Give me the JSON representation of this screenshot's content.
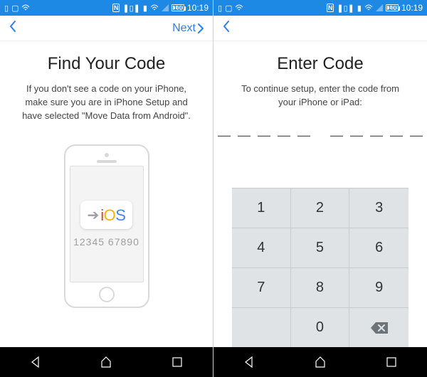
{
  "statusbar": {
    "battery_pct": "100",
    "time": "10:19"
  },
  "left": {
    "nav_next": "Next",
    "title": "Find Your Code",
    "subtitle": "If you don't see a code on your iPhone, make sure you are in iPhone Setup and have selected \"Move Data from Android\".",
    "ios_label": "iOS",
    "sample_code": "12345 67890"
  },
  "right": {
    "title": "Enter Code",
    "subtitle": "To continue setup, enter the code from your iPhone or iPad:",
    "slots": [
      "—",
      "—",
      "—",
      "—",
      "—",
      "—",
      "—",
      "—",
      "—",
      "—"
    ],
    "keypad": [
      "1",
      "2",
      "3",
      "4",
      "5",
      "6",
      "7",
      "8",
      "9",
      "",
      "0",
      "⌫"
    ]
  }
}
